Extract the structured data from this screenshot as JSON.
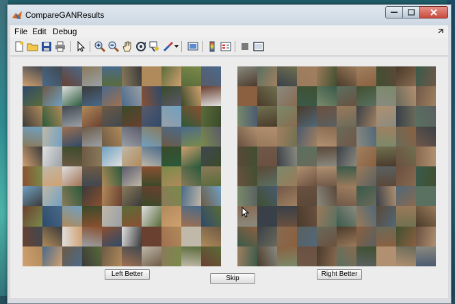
{
  "window": {
    "title": "CompareGANResults"
  },
  "menubar": {
    "items": [
      "File",
      "Edit",
      "Debug"
    ]
  },
  "toolbar": {
    "tools": [
      "new-file-icon",
      "open-folder-icon",
      "save-icon",
      "print-icon",
      "pointer-icon",
      "zoom-in-icon",
      "zoom-out-icon",
      "pan-hand-icon",
      "rotate-3d-icon",
      "data-cursor-icon",
      "brush-icon",
      "link-plot-icon",
      "colorbar-icon",
      "legend-icon",
      "hide-plot-tools-icon",
      "show-plot-tools-icon"
    ]
  },
  "buttons": {
    "left_better": "Left Better",
    "skip": "Skip",
    "right_better": "Right Better"
  },
  "panels": {
    "left_rows": 10,
    "left_cols": 10,
    "right_rows": 10,
    "right_cols": 10
  },
  "colors": {
    "left_palette": [
      "#6d5a45",
      "#2e4a6b",
      "#8a7a5a",
      "#5a6b3a",
      "#9aa0a6",
      "#3a3a3a",
      "#b08a5a",
      "#4a6a8a",
      "#7a8a4a",
      "#c0b8a8",
      "#6a4030",
      "#e0e0e0",
      "#2a5a3a",
      "#8a5030",
      "#5a5a6a",
      "#a07050",
      "#3a4a2a",
      "#d0a070",
      "#404850",
      "#70a0c0"
    ],
    "right_palette": [
      "#5a4838",
      "#3a5a4a",
      "#6a6a5a",
      "#8a6040",
      "#4a5a70",
      "#707050",
      "#a08060",
      "#405030",
      "#5a6060",
      "#886a50",
      "#3a4048",
      "#7a8a6a",
      "#b09070",
      "#506878",
      "#6a5040",
      "#8a8a80",
      "#4a3a2a",
      "#9a7a5a",
      "#5a7060",
      "#705848"
    ]
  }
}
